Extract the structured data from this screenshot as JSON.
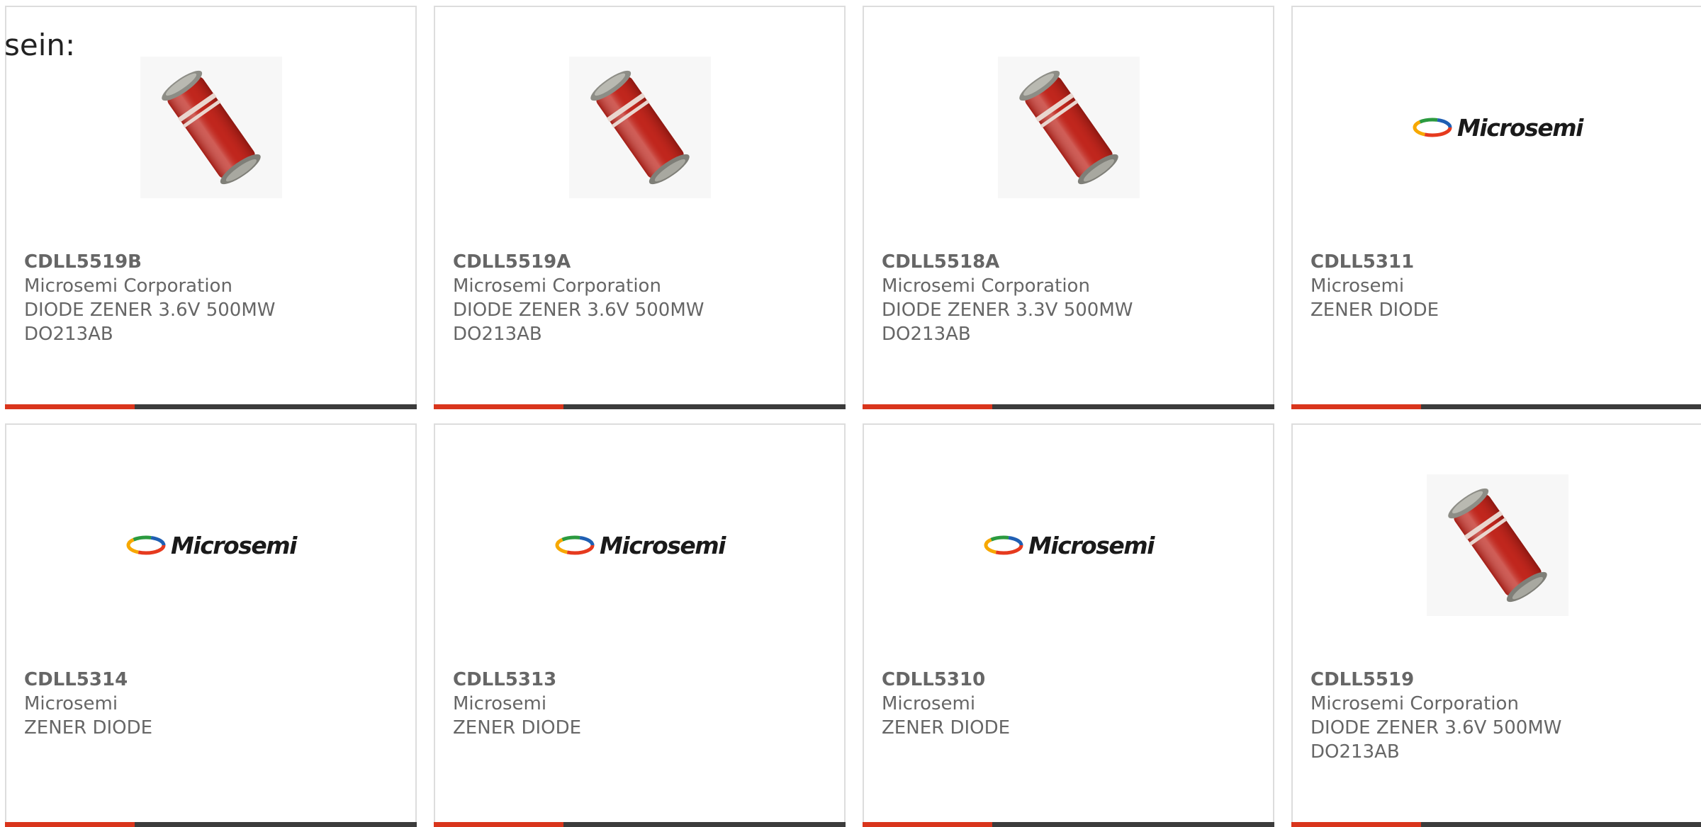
{
  "intro_text": "sein:",
  "colors": {
    "accent": "#d9351c",
    "bar": "#3c3c3c",
    "text": "#666666",
    "border": "#dddddd"
  },
  "products": [
    {
      "part": "CDLL5519B",
      "manufacturer": "Microsemi Corporation",
      "description": "DIODE ZENER 3.6V 500MW",
      "package": "DO213AB",
      "image": "diode-photo"
    },
    {
      "part": "CDLL5519A",
      "manufacturer": "Microsemi Corporation",
      "description": "DIODE ZENER 3.6V 500MW",
      "package": "DO213AB",
      "image": "diode-photo"
    },
    {
      "part": "CDLL5518A",
      "manufacturer": "Microsemi Corporation",
      "description": "DIODE ZENER 3.3V 500MW",
      "package": "DO213AB",
      "image": "diode-photo"
    },
    {
      "part": "CDLL5311",
      "manufacturer": "Microsemi",
      "description": "ZENER DIODE",
      "package": "",
      "image": "microsemi-logo"
    },
    {
      "part": "CDLL5314",
      "manufacturer": "Microsemi",
      "description": "ZENER DIODE",
      "package": "",
      "image": "microsemi-logo"
    },
    {
      "part": "CDLL5313",
      "manufacturer": "Microsemi",
      "description": "ZENER DIODE",
      "package": "",
      "image": "microsemi-logo"
    },
    {
      "part": "CDLL5310",
      "manufacturer": "Microsemi",
      "description": "ZENER DIODE",
      "package": "",
      "image": "microsemi-logo"
    },
    {
      "part": "CDLL5519",
      "manufacturer": "Microsemi Corporation",
      "description": "DIODE ZENER 3.6V 500MW",
      "package": "DO213AB",
      "image": "diode-photo"
    }
  ],
  "logo_text": "Microsemi"
}
